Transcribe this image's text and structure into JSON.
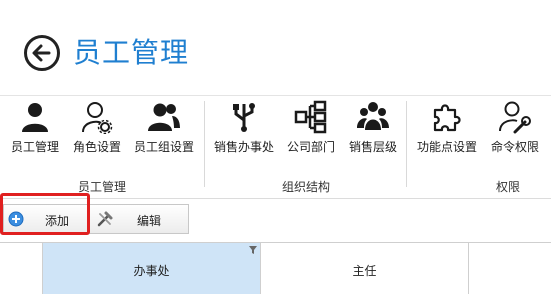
{
  "page": {
    "title": "员工管理"
  },
  "ribbon": {
    "buttons": [
      {
        "label": "员工管理",
        "icon": "user-icon"
      },
      {
        "label": "角色设置",
        "icon": "user-gear-icon"
      },
      {
        "label": "员工组设置",
        "icon": "users-icon"
      },
      {
        "label": "销售办事处",
        "icon": "usb-tree-icon"
      },
      {
        "label": "公司部门",
        "icon": "org-chart-icon"
      },
      {
        "label": "销售层级",
        "icon": "group-icon"
      },
      {
        "label": "功能点设置",
        "icon": "puzzle-icon"
      },
      {
        "label": "命令权限",
        "icon": "user-wrench-icon"
      }
    ],
    "groups": [
      "员工管理",
      "组织结构",
      "权限"
    ]
  },
  "toolbar": {
    "add_label": "添加",
    "edit_label": "编辑"
  },
  "grid": {
    "columns": [
      "办事处",
      "主任"
    ]
  },
  "colors": {
    "title": "#1f7fd0",
    "highlight": "#e02020",
    "selected_header": "#cfe4f7"
  }
}
